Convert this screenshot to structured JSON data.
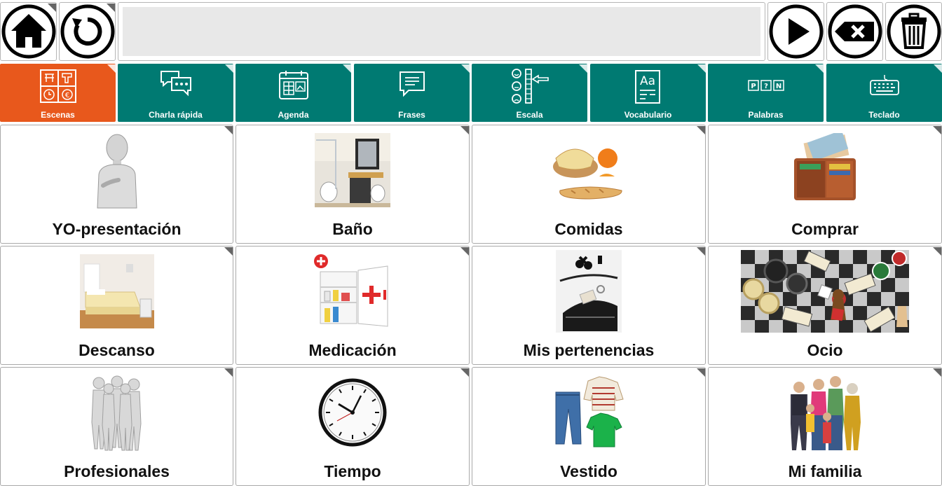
{
  "toolbar": {
    "home": "home-icon",
    "undo": "undo-icon",
    "message": "",
    "play": "play-icon",
    "backspace": "backspace-icon",
    "clear": "trash-icon"
  },
  "categories": [
    {
      "label": "Escenas",
      "icon": "scenes-icon",
      "color": "#e8581c"
    },
    {
      "label": "Charla rápida",
      "icon": "chat-icon",
      "color": "#007a72"
    },
    {
      "label": "Agenda",
      "icon": "calendar-icon",
      "color": "#007a72"
    },
    {
      "label": "Frases",
      "icon": "speech-icon",
      "color": "#007a72"
    },
    {
      "label": "Escala",
      "icon": "scale-icon",
      "color": "#007a72"
    },
    {
      "label": "Vocabulario",
      "icon": "vocabulary-icon",
      "color": "#007a72"
    },
    {
      "label": "Palabras",
      "icon": "words-icon",
      "color": "#007a72"
    },
    {
      "label": "Teclado",
      "icon": "keyboard-icon",
      "color": "#007a72"
    }
  ],
  "cells": [
    {
      "label": "YO-presentación",
      "icon": "self-figure-image"
    },
    {
      "label": "Baño",
      "icon": "bathroom-image"
    },
    {
      "label": "Comidas",
      "icon": "food-image"
    },
    {
      "label": "Comprar",
      "icon": "wallet-image"
    },
    {
      "label": "Descanso",
      "icon": "bedroom-image"
    },
    {
      "label": "Medicación",
      "icon": "medicine-cabinet-image"
    },
    {
      "label": "Mis pertenencias",
      "icon": "belongings-image"
    },
    {
      "label": "Ocio",
      "icon": "board-games-image"
    },
    {
      "label": "Profesionales",
      "icon": "professionals-image"
    },
    {
      "label": "Tiempo",
      "icon": "clock-image"
    },
    {
      "label": "Vestido",
      "icon": "clothes-image"
    },
    {
      "label": "Mi familia",
      "icon": "family-image"
    }
  ]
}
